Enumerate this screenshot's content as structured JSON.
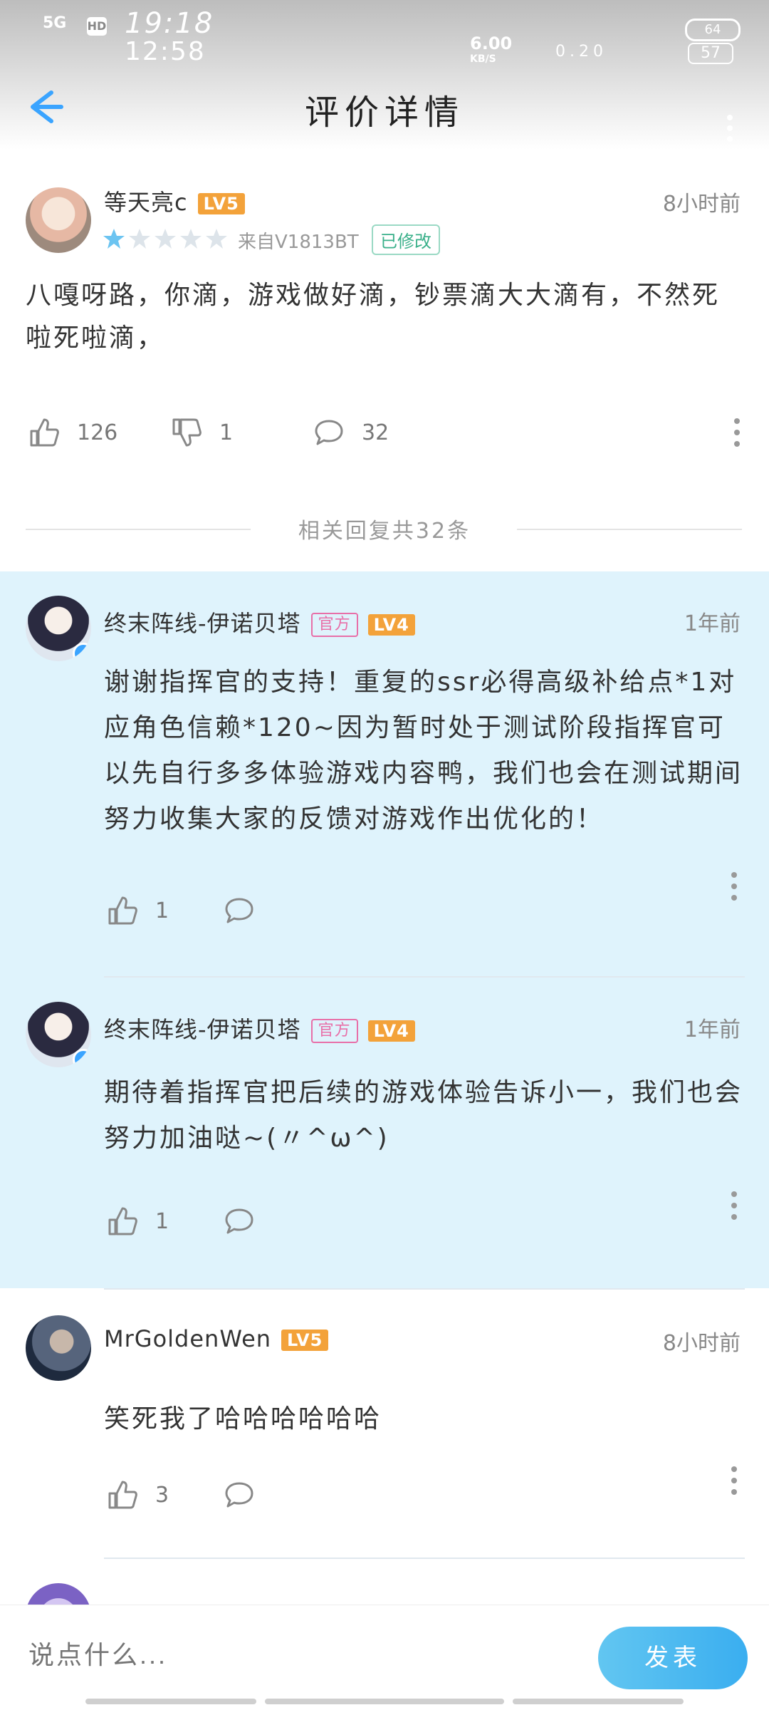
{
  "status_bar": {
    "network": "5G",
    "hd_badge": "HD",
    "time_top": "19:18",
    "time_bottom": "12:58",
    "speed": "6.00",
    "speed_unit": "KB/S",
    "battery_top": "64",
    "battery_bottom": "57",
    "small_speed": "0.20"
  },
  "header": {
    "title": "评价详情"
  },
  "review": {
    "username": "等天亮c",
    "level": "LV5",
    "time": "8小时前",
    "rating": 1,
    "rating_max": 5,
    "device": "来自V1813BT",
    "edited_label": "已修改",
    "content": "八嘎呀路，你滴，游戏做好滴，钞票滴大大滴有，不然死啦死啦滴，",
    "likes": "126",
    "dislikes": "1",
    "comments": "32"
  },
  "divider": {
    "label": "相关回复共32条"
  },
  "replies": [
    {
      "username": "终末阵线-伊诺贝塔",
      "official_tag": "官方",
      "level": "LV4",
      "time": "1年前",
      "content": "谢谢指挥官的支持！重复的ssr必得高级补给点*1对应角色信赖*120~因为暂时处于测试阶段指挥官可以先自行多多体验游戏内容鸭，我们也会在测试期间努力收集大家的反馈对游戏作出优化的！",
      "likes": "1"
    },
    {
      "username": "终末阵线-伊诺贝塔",
      "official_tag": "官方",
      "level": "LV4",
      "time": "1年前",
      "content": "期待着指挥官把后续的游戏体验告诉小一，我们也会努力加油哒~(〃^ω^)",
      "likes": "1"
    },
    {
      "username": "MrGoldenWen",
      "level": "LV5",
      "time": "8小时前",
      "content": "笑死我了哈哈哈哈哈哈",
      "likes": "3"
    }
  ],
  "composer": {
    "placeholder": "说点什么...",
    "send_label": "发表"
  },
  "colors": {
    "accent": "#3aaef0",
    "official_bg": "#dff3fc",
    "level_badge": "#f3a23a",
    "official_tag": "#e86fa8",
    "star_active": "#6cc4f1"
  }
}
